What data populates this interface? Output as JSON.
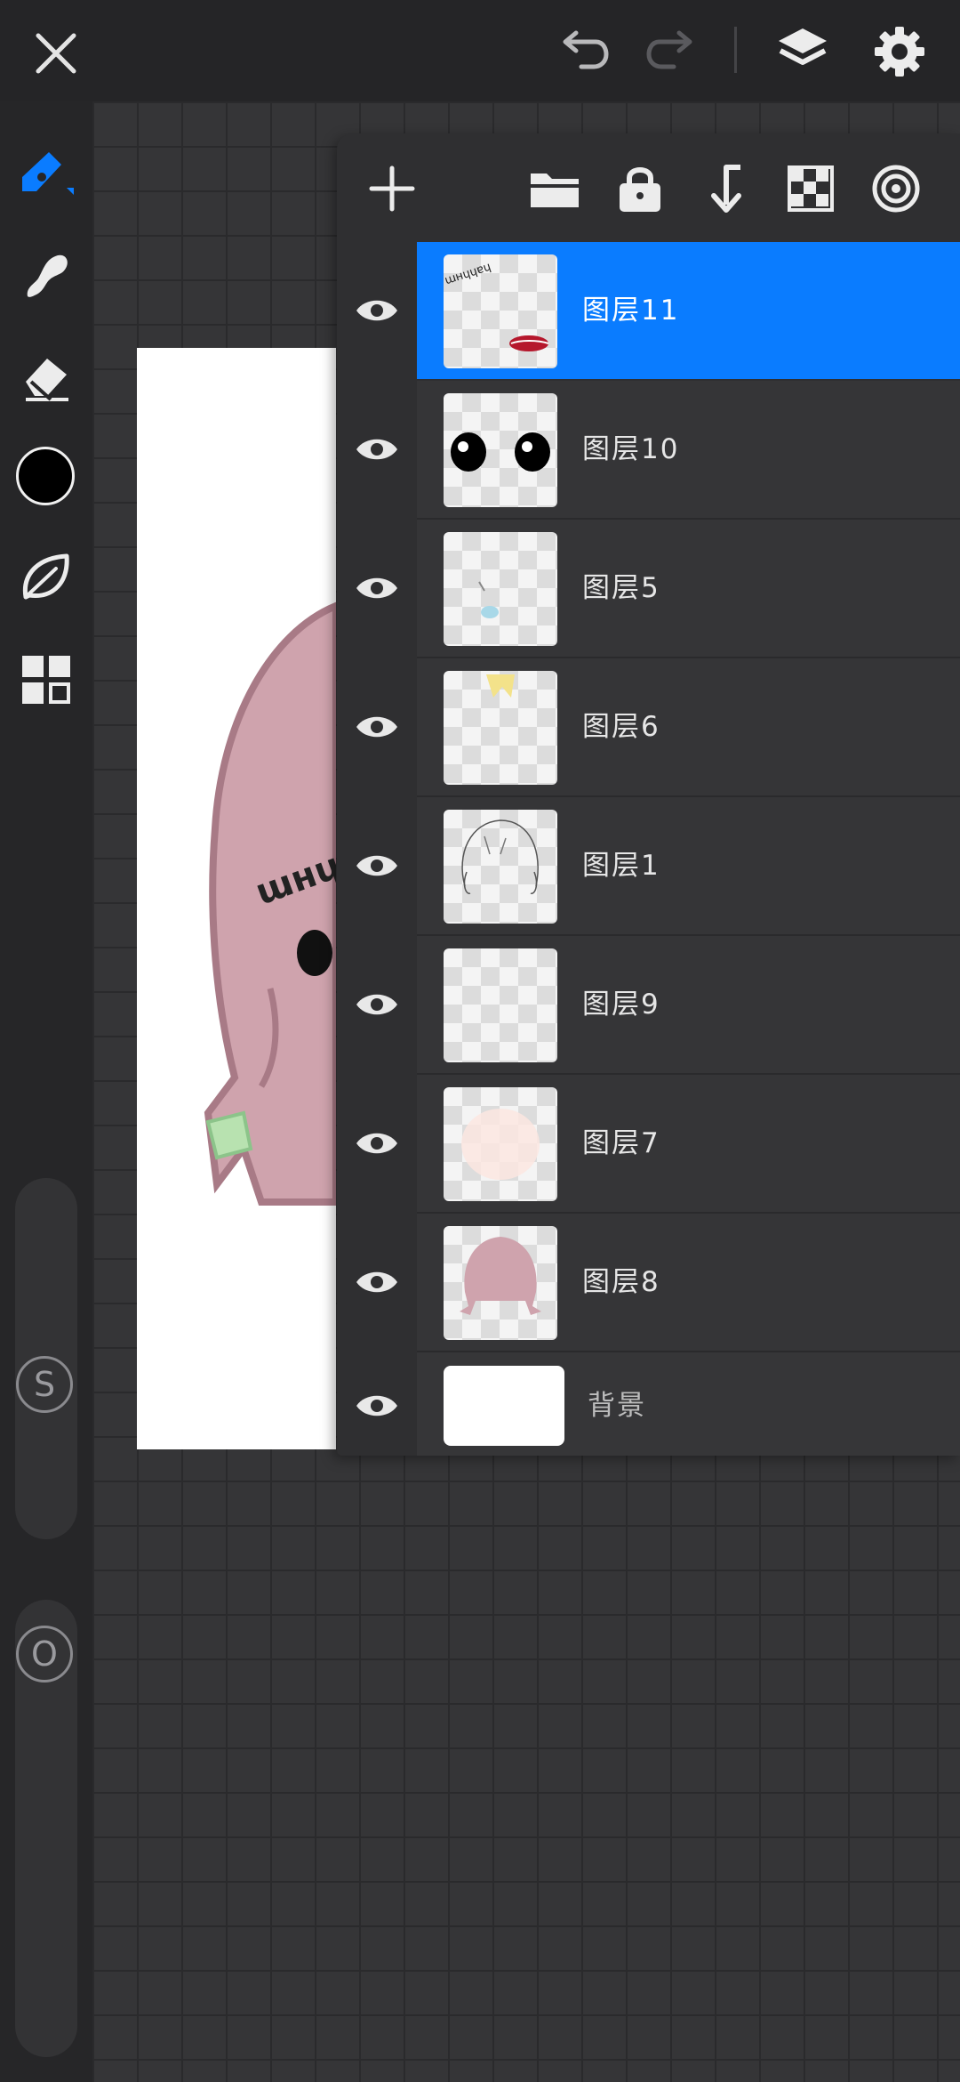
{
  "topbar": {
    "close": "close-icon",
    "undo": "undo-icon",
    "redo": "redo-icon",
    "layers": "layers-icon",
    "settings": "gear-icon"
  },
  "tools": [
    "brush-icon",
    "smudge-icon",
    "eraser-icon",
    "color-swatch",
    "leaf-icon",
    "grid-icon"
  ],
  "color": {
    "current": "#000000",
    "accent": "#0a7cff"
  },
  "sliders": {
    "size_label": "S",
    "opacity_label": "O"
  },
  "canvas": {
    "doc_text": "ɯнɥɥɐɥ"
  },
  "layers_panel": {
    "toolbar": [
      "plus-icon",
      "folder-icon",
      "lock-icon",
      "merge-down-icon",
      "checker-icon",
      "target-icon"
    ],
    "layers": [
      {
        "name": "图层11",
        "visible": true,
        "selected": true
      },
      {
        "name": "图层10",
        "visible": true,
        "selected": false
      },
      {
        "name": "图层5",
        "visible": true,
        "selected": false
      },
      {
        "name": "图层6",
        "visible": true,
        "selected": false
      },
      {
        "name": "图层1",
        "visible": true,
        "selected": false
      },
      {
        "name": "图层9",
        "visible": true,
        "selected": false
      },
      {
        "name": "图层7",
        "visible": true,
        "selected": false
      },
      {
        "name": "图层8",
        "visible": true,
        "selected": false
      }
    ],
    "background_layer": {
      "name": "背景",
      "visible": true
    }
  }
}
